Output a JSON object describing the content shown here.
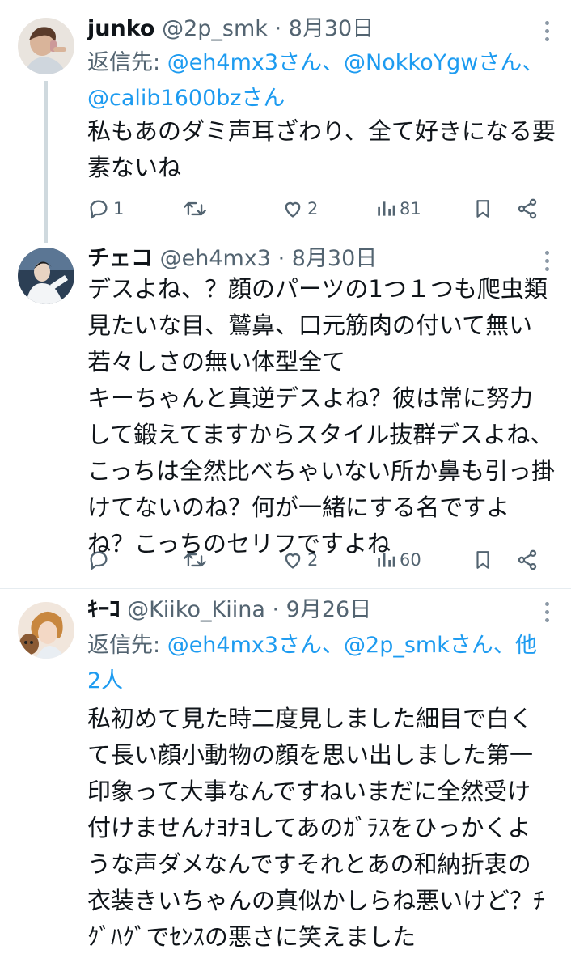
{
  "tweets": [
    {
      "name": "junko",
      "handle": "@2p_smk",
      "separator": "·",
      "date": "8月30日",
      "reply_to_label": "返信先: ",
      "reply_to_mentions": "@eh4mx3さん、@NokkoYgwさん、@calib1600bzさん",
      "text": "私もあのダミ声耳ざわり、全て好きになる要素ないね",
      "reply_count": "1",
      "retweet_count": "",
      "like_count": "2",
      "view_count": "81",
      "icons": [
        "reply-icon",
        "retweet-icon",
        "like-icon",
        "views-icon",
        "bookmark-icon",
        "share-icon"
      ]
    },
    {
      "name": "チェコ",
      "handle": "@eh4mx3",
      "separator": "·",
      "date": "8月30日",
      "text": "デスよね、？顔のパーツの1つ１つも爬虫類見たいな目、鷲鼻、口元筋肉の付いて無い若々しさの無い体型全て\nキーちゃんと真逆デスよね？彼は常に努力して鍛えてますからスタイル抜群デスよね、こっちは全然比べちゃいない所か鼻も引っ掛けてないのね？何が一緒にする名ですよね？こっちのセリフですよね",
      "reply_count": "",
      "retweet_count": "",
      "like_count": "2",
      "view_count": "60"
    },
    {
      "name": "ｷｰｺ",
      "handle": "@Kiiko_Kiina",
      "separator": "·",
      "date": "9月26日",
      "reply_to_label": "返信先: ",
      "reply_to_mentions": "@eh4mx3さん、@2p_smkさん、他2人",
      "text": "私初めて見た時二度見しました細目で白くて長い顔小動物の顔を思い出しました第一印象って大事なんですねいまだに全然受け付けませんﾅﾖﾅﾖしてあのｶﾞﾗｽをひっかくような声ダメなんですそれとあの和納折衷の衣装きいちゃんの真似かしらね悪いけど？ﾁｸﾞﾊｸﾞでｾﾝｽの悪さに笑えました"
    }
  ],
  "colors": {
    "text": "#0f1419",
    "secondary": "#536471",
    "link": "#1d9bf0",
    "divider": "#e6ecf0",
    "thread_line": "#cfd9de"
  }
}
